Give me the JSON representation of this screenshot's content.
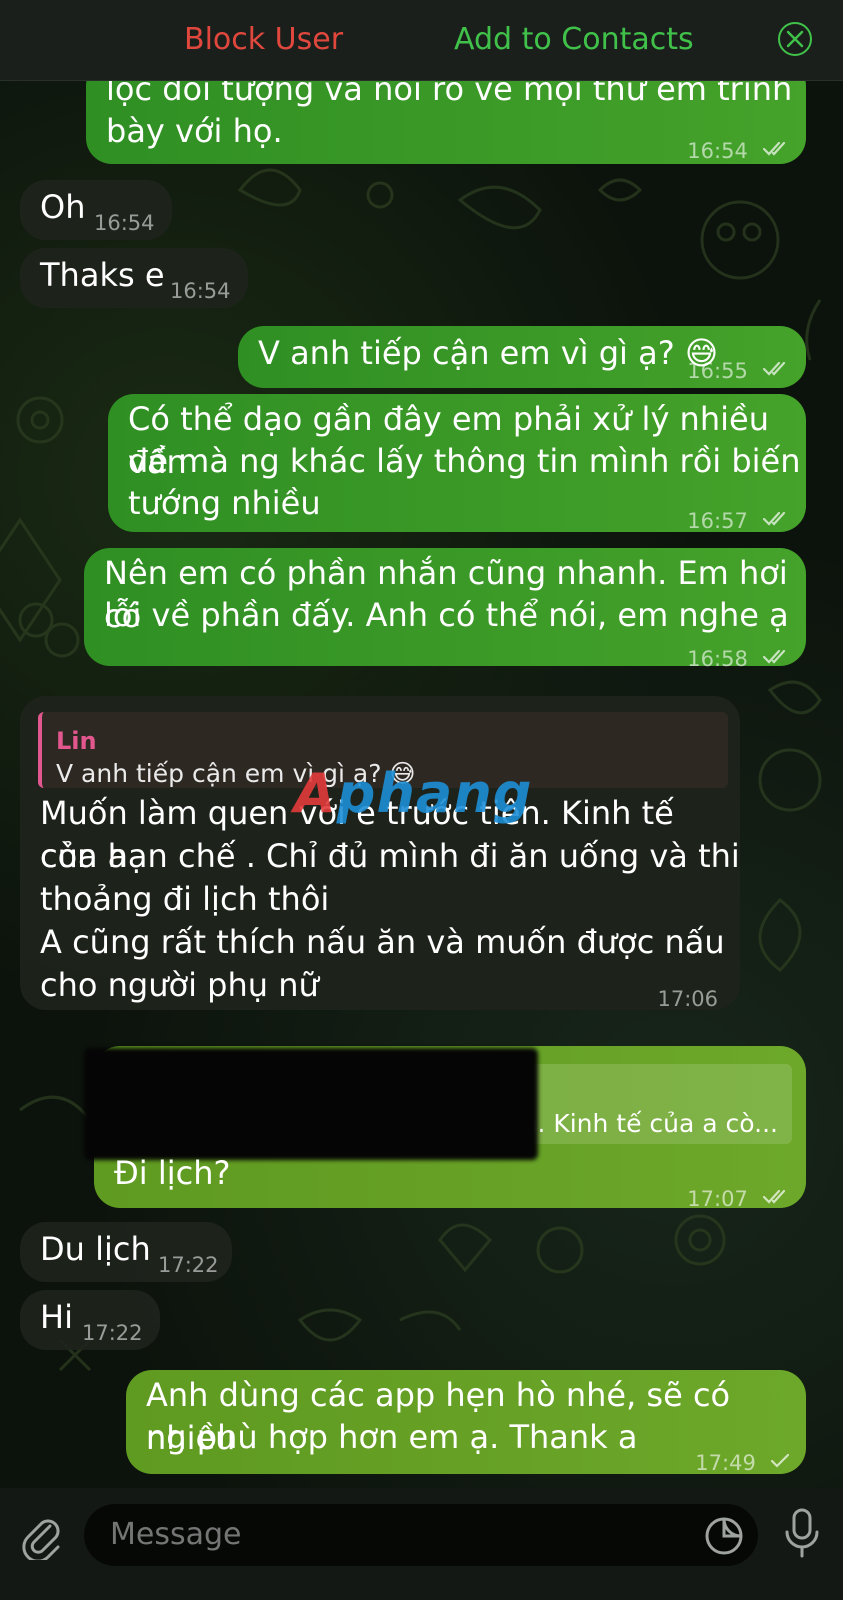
{
  "topbar": {
    "block_user": "Block User",
    "add_to_contacts": "Add to Contacts"
  },
  "messages": [
    {
      "dir": "out",
      "text": "lọc đối tượng và nói rõ về mọi thứ em trình bày với họ.",
      "time": "16:54",
      "status": "read"
    },
    {
      "dir": "in",
      "text": "Oh",
      "time": "16:54"
    },
    {
      "dir": "in",
      "text": "Thaks e",
      "time": "16:54"
    },
    {
      "dir": "out",
      "text": "V anh tiếp cận em vì gì ạ? 😅",
      "time": "16:55",
      "status": "read"
    },
    {
      "dir": "out",
      "text": "Có thể dạo gần đây em phải xử lý nhiều vấn đề mà ng khác lấy thông tin mình rồi biến tướng nhiều",
      "time": "16:57",
      "status": "read"
    },
    {
      "dir": "out",
      "text": "Nên em có phần nhắn cũng nhanh. Em hơi có lỗi về phần đấy. Anh có thể nói, em nghe ạ",
      "time": "16:58",
      "status": "read"
    },
    {
      "dir": "in",
      "reply_name": "Lin",
      "reply_text": "V anh tiếp cận em vì gì ạ? 😅",
      "text": "Muốn làm quen với e trước tiên. Kinh tế của a còn hạn chế . Chỉ đủ mình đi ăn uống và thi thoảng đi lịch thôi\nA cũng rất thích nấu ăn và muốn được nấu cho người phụ nữ",
      "time": "17:06"
    },
    {
      "dir": "out",
      "reply_text": "Muốn làm quen với e trước tiên. Kinh tế của a cò...",
      "text": "Đi lịch?",
      "time": "17:07",
      "status": "read"
    },
    {
      "dir": "in",
      "text": "Du lịch",
      "time": "17:22"
    },
    {
      "dir": "in",
      "text": "Hi",
      "time": "17:22"
    },
    {
      "dir": "out",
      "text": "Anh dùng các app hẹn hò nhé, sẽ có nhiều ng phù hợp hơn em ạ. Thank a",
      "time": "17:49",
      "status": "sent"
    }
  ],
  "lines": {
    "m0": [
      "lọc đối tượng và nói rõ về mọi thứ em trình",
      "bày với họ."
    ],
    "m4": [
      "Có thể dạo gần đây em phải xử lý nhiều vấn",
      "đề mà ng khác lấy thông tin mình rồi biến",
      "tướng nhiều"
    ],
    "m5": [
      "Nên em có phần nhắn cũng nhanh. Em hơi có",
      "lỗi về phần đấy. Anh có thể nói, em nghe ạ"
    ],
    "m6": [
      "Muốn làm quen với e trước tiên. Kinh tế của a",
      "còn hạn chế . Chỉ đủ mình đi ăn uống và thi",
      "thoảng đi lịch thôi",
      "A cũng rất thích nấu ăn và muốn được nấu",
      "cho người phụ nữ"
    ],
    "m10": [
      "Anh dùng các app hẹn hò nhé, sẽ có nhiều",
      "ng phù hợp hơn em ạ. Thank a"
    ]
  },
  "watermark": {
    "first": "A",
    "rest": "phang"
  },
  "composer": {
    "placeholder": "Message"
  },
  "icons": [
    "close-icon",
    "attach-icon",
    "sticker-icon",
    "microphone-icon",
    "double-check-icon",
    "single-check-icon"
  ],
  "colors": {
    "outgoing": "#3a9a27",
    "incoming": "#1e241c",
    "block": "#e0473d",
    "add": "#40c24a",
    "reply_accent": "#e2578e"
  }
}
